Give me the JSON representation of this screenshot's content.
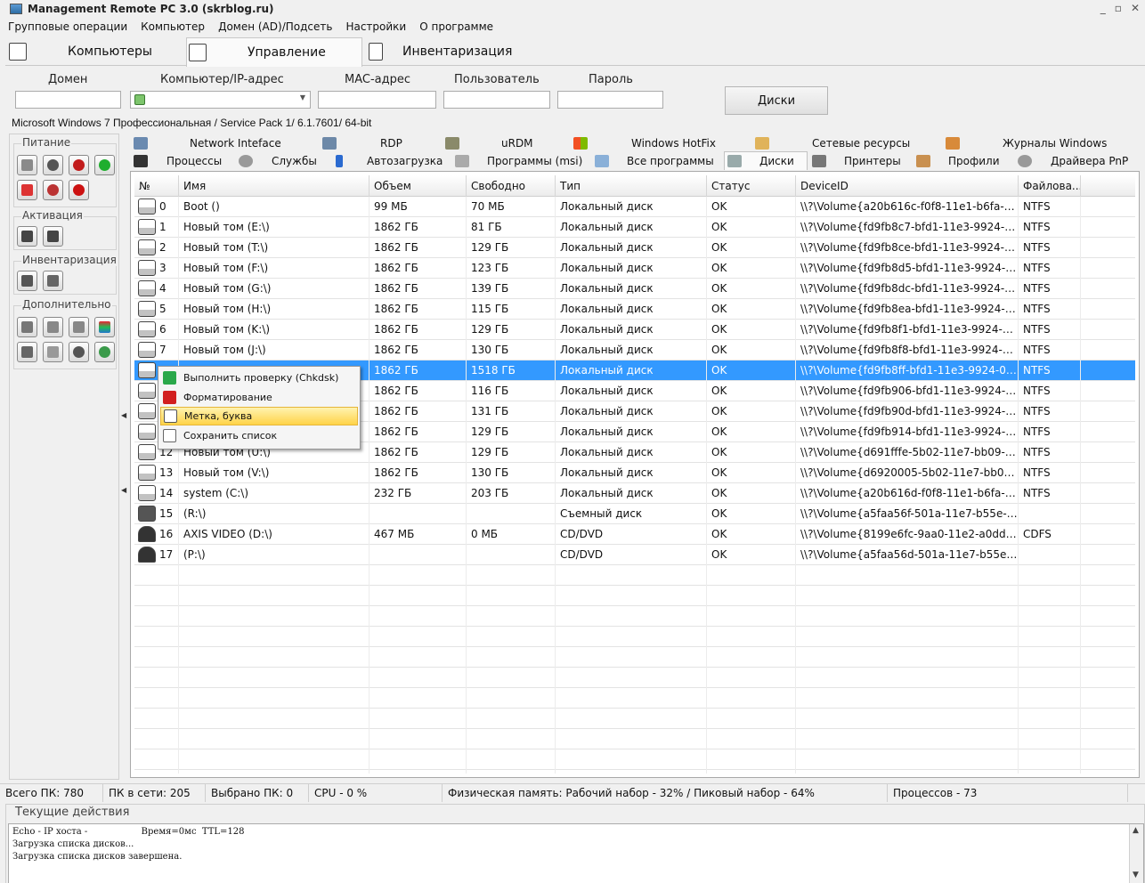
{
  "window": {
    "title": "Management Remote PC 3.0 (skrblog.ru)",
    "controls": [
      "_",
      "▫",
      "✕"
    ]
  },
  "menu": [
    "Групповые операции",
    "Компьютер",
    "Домен (AD)/Подсеть",
    "Настройки",
    "О программе"
  ],
  "main_tabs": [
    {
      "label": "Компьютеры",
      "icon": "computers-icon"
    },
    {
      "label": "Управление",
      "icon": "management-icon"
    },
    {
      "label": "Инвентаризация",
      "icon": "inventory-icon"
    }
  ],
  "connection": {
    "domain_label": "Домен",
    "domain_value": "",
    "computer_label": "Компьютер/IP-адрес",
    "computer_value": "",
    "mac_label": "MAC-адрес",
    "mac_value": "",
    "user_label": "Пользователь",
    "user_value": "",
    "password_label": "Пароль",
    "password_value": "",
    "action_button": "Диски"
  },
  "os_info": "Microsoft Windows 7 Профессиональная / Service Pack 1/ 6.1.7601/ 64-bit",
  "sidebar": {
    "groups": [
      {
        "title": "Питание"
      },
      {
        "title": "Активация"
      },
      {
        "title": "Инвентаризация"
      },
      {
        "title": "Дополнительно"
      }
    ]
  },
  "sub_tabs_row1": [
    "Network Inteface",
    "RDP",
    "uRDM",
    "Windows HotFix",
    "Сетевые ресурсы",
    "Журналы Windows"
  ],
  "sub_tabs_row2": [
    "Процессы",
    "Службы",
    "Автозагрузка",
    "Программы (msi)",
    "Все программы",
    "Диски",
    "Принтеры",
    "Профили",
    "Драйвера PnP"
  ],
  "table": {
    "headers": [
      "№",
      "Имя",
      "Объем",
      "Свободно",
      "Тип",
      "Статус",
      "DeviceID",
      "Файлова..."
    ],
    "rows": [
      {
        "num": "0",
        "name": "Boot ()",
        "size": "99 МБ",
        "free": "70 МБ",
        "type": "Локальный диск",
        "status": "OK",
        "device": "\\\\?\\Volume{a20b616c-f0f8-11e1-b6fa-80...",
        "fs": "NTFS",
        "kind": "hdd"
      },
      {
        "num": "1",
        "name": "Новый том (E:\\)",
        "size": "1862 ГБ",
        "free": "81 ГБ",
        "type": "Локальный диск",
        "status": "OK",
        "device": "\\\\?\\Volume{fd9fb8c7-bfd1-11e3-9924-0...",
        "fs": "NTFS",
        "kind": "hdd"
      },
      {
        "num": "2",
        "name": "Новый том (T:\\)",
        "size": "1862 ГБ",
        "free": "129 ГБ",
        "type": "Локальный диск",
        "status": "OK",
        "device": "\\\\?\\Volume{fd9fb8ce-bfd1-11e3-9924-0...",
        "fs": "NTFS",
        "kind": "hdd"
      },
      {
        "num": "3",
        "name": "Новый том (F:\\)",
        "size": "1862 ГБ",
        "free": "123 ГБ",
        "type": "Локальный диск",
        "status": "OK",
        "device": "\\\\?\\Volume{fd9fb8d5-bfd1-11e3-9924-0...",
        "fs": "NTFS",
        "kind": "hdd"
      },
      {
        "num": "4",
        "name": "Новый том (G:\\)",
        "size": "1862 ГБ",
        "free": "139 ГБ",
        "type": "Локальный диск",
        "status": "OK",
        "device": "\\\\?\\Volume{fd9fb8dc-bfd1-11e3-9924-0...",
        "fs": "NTFS",
        "kind": "hdd"
      },
      {
        "num": "5",
        "name": "Новый том (H:\\)",
        "size": "1862 ГБ",
        "free": "115 ГБ",
        "type": "Локальный диск",
        "status": "OK",
        "device": "\\\\?\\Volume{fd9fb8ea-bfd1-11e3-9924-0...",
        "fs": "NTFS",
        "kind": "hdd"
      },
      {
        "num": "6",
        "name": "Новый том (K:\\)",
        "size": "1862 ГБ",
        "free": "129 ГБ",
        "type": "Локальный диск",
        "status": "OK",
        "device": "\\\\?\\Volume{fd9fb8f1-bfd1-11e3-9924-00...",
        "fs": "NTFS",
        "kind": "hdd"
      },
      {
        "num": "7",
        "name": "Новый том (J:\\)",
        "size": "1862 ГБ",
        "free": "130 ГБ",
        "type": "Локальный диск",
        "status": "OK",
        "device": "\\\\?\\Volume{fd9fb8f8-bfd1-11e3-9924-00...",
        "fs": "NTFS",
        "kind": "hdd"
      },
      {
        "num": "",
        "name": "",
        "size": "1862 ГБ",
        "free": "1518 ГБ",
        "type": "Локальный диск",
        "status": "OK",
        "device": "\\\\?\\Volume{fd9fb8ff-bfd1-11e3-9924-00...",
        "fs": "NTFS",
        "kind": "hdd",
        "selected": true
      },
      {
        "num": "",
        "name": "",
        "size": "1862 ГБ",
        "free": "116 ГБ",
        "type": "Локальный диск",
        "status": "OK",
        "device": "\\\\?\\Volume{fd9fb906-bfd1-11e3-9924-0...",
        "fs": "NTFS",
        "kind": "hdd"
      },
      {
        "num": "",
        "name": "",
        "size": "1862 ГБ",
        "free": "131 ГБ",
        "type": "Локальный диск",
        "status": "OK",
        "device": "\\\\?\\Volume{fd9fb90d-bfd1-11e3-9924-0...",
        "fs": "NTFS",
        "kind": "hdd"
      },
      {
        "num": "",
        "name": "",
        "size": "1862 ГБ",
        "free": "129 ГБ",
        "type": "Локальный диск",
        "status": "OK",
        "device": "\\\\?\\Volume{fd9fb914-bfd1-11e3-9924-0...",
        "fs": "NTFS",
        "kind": "hdd"
      },
      {
        "num": "12",
        "name": "Новый том (U:\\)",
        "size": "1862 ГБ",
        "free": "129 ГБ",
        "type": "Локальный диск",
        "status": "OK",
        "device": "\\\\?\\Volume{d691fffe-5b02-11e7-bb09-0...",
        "fs": "NTFS",
        "kind": "hdd"
      },
      {
        "num": "13",
        "name": "Новый том (V:\\)",
        "size": "1862 ГБ",
        "free": "130 ГБ",
        "type": "Локальный диск",
        "status": "OK",
        "device": "\\\\?\\Volume{d6920005-5b02-11e7-bb09-...",
        "fs": "NTFS",
        "kind": "hdd"
      },
      {
        "num": "14",
        "name": "system (C:\\)",
        "size": "232 ГБ",
        "free": "203 ГБ",
        "type": "Локальный диск",
        "status": "OK",
        "device": "\\\\?\\Volume{a20b616d-f0f8-11e1-b6fa-8...",
        "fs": "NTFS",
        "kind": "hdd"
      },
      {
        "num": "15",
        "name": " (R:\\)",
        "size": "",
        "free": "",
        "type": "Съемный диск",
        "status": "OK",
        "device": "\\\\?\\Volume{a5faa56f-501a-11e7-b55e-0...",
        "fs": "",
        "kind": "usb"
      },
      {
        "num": "16",
        "name": "AXIS VIDEO (D:\\)",
        "size": "467 МБ",
        "free": "0 МБ",
        "type": "CD/DVD",
        "status": "OK",
        "device": "\\\\?\\Volume{8199e6fc-9aa0-11e2-a0dd-8...",
        "fs": "CDFS",
        "kind": "cd"
      },
      {
        "num": "17",
        "name": " (P:\\)",
        "size": "",
        "free": "",
        "type": "CD/DVD",
        "status": "OK",
        "device": "\\\\?\\Volume{a5faa56d-501a-11e7-b55e-0...",
        "fs": "",
        "kind": "cd"
      }
    ]
  },
  "context_menu": {
    "items": [
      {
        "label": "Выполнить проверку (Chkdsk)",
        "icon": "chkdsk-icon",
        "color": "#2aa84a"
      },
      {
        "label": "Форматирование",
        "icon": "format-icon",
        "color": "#d21f1f"
      },
      {
        "label": "Метка, буква",
        "icon": "label-icon",
        "color": "#666666",
        "highlighted": true
      },
      {
        "label": "Сохранить список",
        "icon": "save-list-icon",
        "color": "#777777"
      }
    ]
  },
  "status_bar": {
    "total": "Всего ПК: 780",
    "online": "ПК в сети: 205",
    "selected": "Выбрано ПК: 0",
    "cpu": "CPU - 0 %",
    "memory": "Физическая память: Рабочий набор - 32% / Пиковый набор - 64%",
    "processes": "Процессов - 73"
  },
  "actions": {
    "title": "Текущие действия",
    "log": [
      "Echo - IP хоста -                   Время=0мс  TTL=128",
      "Загрузка списка дисков...",
      "Загрузка списка дисков завершена."
    ]
  },
  "colors": {
    "selection": "#3399ff",
    "menu_highlight": "#ffd348"
  }
}
